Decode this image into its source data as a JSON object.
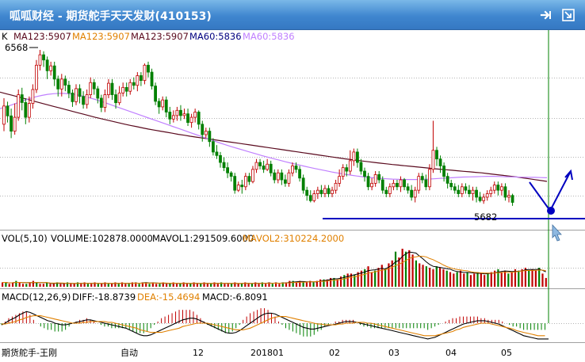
{
  "window": {
    "title": "呱呱财经 - 期货舵手天天发财(410153)",
    "pin_icon": "pin-icon",
    "restore_icon": "restore-icon"
  },
  "colors": {
    "up": "#c00000",
    "down": "#008000",
    "ma123": "#5a0a1e",
    "ma60": "#c080ff",
    "mavol1": "#000000",
    "mavol2": "#e08000",
    "diff": "#000000",
    "dea": "#e08000",
    "annotation": "#0000c0",
    "grid": "#b4b4b4"
  },
  "price_panel": {
    "k_label": "K",
    "ma123_a": "MA123:5907",
    "ma123_b": "MA123:5907",
    "ma123_c": "MA123:5907",
    "ma60_a": "MA60:5836",
    "ma60_b": "MA60:5836",
    "high_label": "6568",
    "low_label": "5682"
  },
  "volume_panel": {
    "vol_label": "VOL(5,10)",
    "volume": "VOLUME:102878.0000",
    "mavol1": "MAVOL1:291509.6000",
    "mavol2": "MAVOL2:310224.2000"
  },
  "macd_panel": {
    "macd_label": "MACD(12,26,9)",
    "diff": "DIFF:-18.8739",
    "dea": "DEA:-15.4694",
    "macd": "MACD:-6.8091"
  },
  "footer": {
    "author": "期货舵手-王刚",
    "auto": "自动"
  },
  "x_axis": {
    "labels": [
      "12",
      "201801",
      "02",
      "03",
      "04",
      "05"
    ]
  },
  "chart_data": {
    "type": "candlestick",
    "symbol": "410153",
    "price_range": [
      5560,
      6600
    ],
    "marked_high": 6568,
    "marked_low": 5682,
    "candles": [
      [
        6140,
        6245,
        6100,
        6290
      ],
      [
        6245,
        6188,
        6150,
        6270
      ],
      [
        6188,
        6100,
        6060,
        6230
      ],
      [
        6100,
        6180,
        6080,
        6260
      ],
      [
        6180,
        6310,
        6160,
        6340
      ],
      [
        6310,
        6265,
        6220,
        6350
      ],
      [
        6265,
        6180,
        6140,
        6290
      ],
      [
        6180,
        6260,
        6150,
        6300
      ],
      [
        6260,
        6340,
        6230,
        6370
      ],
      [
        6340,
        6480,
        6320,
        6510
      ],
      [
        6480,
        6540,
        6450,
        6568
      ],
      [
        6540,
        6510,
        6470,
        6560
      ],
      [
        6510,
        6448,
        6400,
        6530
      ],
      [
        6448,
        6476,
        6420,
        6500
      ],
      [
        6476,
        6400,
        6360,
        6500
      ],
      [
        6400,
        6343,
        6300,
        6420
      ],
      [
        6343,
        6400,
        6300,
        6430
      ],
      [
        6400,
        6365,
        6330,
        6420
      ],
      [
        6365,
        6320,
        6290,
        6390
      ],
      [
        6320,
        6270,
        6240,
        6340
      ],
      [
        6270,
        6345,
        6250,
        6370
      ],
      [
        6345,
        6300,
        6260,
        6370
      ],
      [
        6300,
        6254,
        6230,
        6330
      ],
      [
        6254,
        6310,
        6230,
        6340
      ],
      [
        6310,
        6380,
        6290,
        6410
      ],
      [
        6380,
        6344,
        6310,
        6400
      ],
      [
        6344,
        6290,
        6260,
        6360
      ],
      [
        6290,
        6237,
        6210,
        6310
      ],
      [
        6237,
        6310,
        6210,
        6340
      ],
      [
        6310,
        6376,
        6290,
        6400
      ],
      [
        6376,
        6310,
        6280,
        6400
      ],
      [
        6310,
        6264,
        6230,
        6340
      ],
      [
        6264,
        6320,
        6250,
        6360
      ],
      [
        6320,
        6352,
        6300,
        6380
      ],
      [
        6352,
        6330,
        6300,
        6380
      ],
      [
        6330,
        6380,
        6310,
        6400
      ],
      [
        6380,
        6364,
        6340,
        6410
      ],
      [
        6364,
        6420,
        6330,
        6440
      ],
      [
        6420,
        6392,
        6360,
        6440
      ],
      [
        6392,
        6480,
        6370,
        6490
      ],
      [
        6480,
        6440,
        6410,
        6500
      ],
      [
        6440,
        6360,
        6340,
        6460
      ],
      [
        6360,
        6272,
        6250,
        6380
      ],
      [
        6272,
        6240,
        6200,
        6290
      ],
      [
        6240,
        6280,
        6220,
        6300
      ],
      [
        6280,
        6210,
        6180,
        6300
      ],
      [
        6210,
        6170,
        6140,
        6240
      ],
      [
        6170,
        6190,
        6150,
        6220
      ],
      [
        6190,
        6220,
        6160,
        6240
      ],
      [
        6220,
        6190,
        6160,
        6250
      ],
      [
        6190,
        6200,
        6170,
        6230
      ],
      [
        6200,
        6150,
        6130,
        6230
      ],
      [
        6150,
        6180,
        6120,
        6200
      ],
      [
        6180,
        6210,
        6150,
        6230
      ],
      [
        6210,
        6140,
        6110,
        6220
      ],
      [
        6140,
        6080,
        6040,
        6160
      ],
      [
        6080,
        6100,
        6060,
        6120
      ],
      [
        6100,
        6040,
        6010,
        6120
      ],
      [
        6040,
        5980,
        5960,
        6060
      ],
      [
        5980,
        5960,
        5940,
        6020
      ],
      [
        5960,
        5920,
        5890,
        5980
      ],
      [
        5920,
        5890,
        5870,
        5950
      ],
      [
        5890,
        5860,
        5830,
        5920
      ],
      [
        5860,
        5840,
        5810,
        5870
      ],
      [
        5840,
        5760,
        5740,
        5860
      ],
      [
        5760,
        5790,
        5750,
        5810
      ],
      [
        5790,
        5780,
        5740,
        5820
      ],
      [
        5780,
        5840,
        5760,
        5860
      ],
      [
        5840,
        5810,
        5790,
        5860
      ],
      [
        5810,
        5880,
        5800,
        5900
      ],
      [
        5880,
        5920,
        5860,
        5940
      ],
      [
        5920,
        5900,
        5880,
        5940
      ],
      [
        5900,
        5880,
        5860,
        5930
      ],
      [
        5880,
        5910,
        5870,
        5940
      ],
      [
        5910,
        5860,
        5840,
        5930
      ],
      [
        5860,
        5820,
        5800,
        5880
      ],
      [
        5820,
        5860,
        5800,
        5880
      ],
      [
        5860,
        5820,
        5790,
        5880
      ],
      [
        5820,
        5800,
        5780,
        5850
      ],
      [
        5800,
        5860,
        5780,
        5880
      ],
      [
        5860,
        5900,
        5840,
        5920
      ],
      [
        5900,
        5880,
        5860,
        5920
      ],
      [
        5880,
        5830,
        5810,
        5900
      ],
      [
        5830,
        5760,
        5740,
        5850
      ],
      [
        5760,
        5730,
        5700,
        5780
      ],
      [
        5730,
        5700,
        5690,
        5760
      ],
      [
        5700,
        5740,
        5690,
        5760
      ],
      [
        5740,
        5760,
        5710,
        5780
      ],
      [
        5760,
        5740,
        5720,
        5790
      ],
      [
        5740,
        5770,
        5720,
        5790
      ],
      [
        5770,
        5740,
        5720,
        5790
      ],
      [
        5740,
        5760,
        5720,
        5780
      ],
      [
        5760,
        5800,
        5740,
        5820
      ],
      [
        5800,
        5840,
        5780,
        5880
      ],
      [
        5840,
        5890,
        5820,
        5910
      ],
      [
        5890,
        5870,
        5840,
        5910
      ],
      [
        5870,
        5930,
        5850,
        5990
      ],
      [
        5930,
        5980,
        5900,
        6000
      ],
      [
        5980,
        5920,
        5890,
        6000
      ],
      [
        5920,
        5870,
        5850,
        5940
      ],
      [
        5870,
        5840,
        5810,
        5890
      ],
      [
        5840,
        5780,
        5760,
        5860
      ],
      [
        5780,
        5800,
        5760,
        5830
      ],
      [
        5800,
        5850,
        5780,
        5870
      ],
      [
        5850,
        5820,
        5800,
        5870
      ],
      [
        5820,
        5760,
        5740,
        5840
      ],
      [
        5760,
        5740,
        5720,
        5780
      ],
      [
        5740,
        5780,
        5720,
        5800
      ],
      [
        5780,
        5800,
        5760,
        5820
      ],
      [
        5800,
        5780,
        5760,
        5820
      ],
      [
        5780,
        5820,
        5750,
        5840
      ],
      [
        5820,
        5780,
        5760,
        5830
      ],
      [
        5780,
        5760,
        5740,
        5800
      ],
      [
        5760,
        5720,
        5700,
        5790
      ],
      [
        5720,
        5760,
        5690,
        5780
      ],
      [
        5760,
        5840,
        5740,
        5860
      ],
      [
        5840,
        5820,
        5800,
        5860
      ],
      [
        5820,
        5780,
        5760,
        5850
      ],
      [
        5780,
        5880,
        5760,
        5910
      ],
      [
        5880,
        5990,
        5860,
        6160
      ],
      [
        5990,
        5940,
        5900,
        6010
      ],
      [
        5940,
        5900,
        5860,
        5960
      ],
      [
        5900,
        5840,
        5810,
        5920
      ],
      [
        5840,
        5800,
        5770,
        5860
      ],
      [
        5800,
        5780,
        5760,
        5820
      ],
      [
        5780,
        5760,
        5740,
        5800
      ],
      [
        5760,
        5740,
        5720,
        5790
      ],
      [
        5740,
        5780,
        5720,
        5800
      ],
      [
        5780,
        5760,
        5740,
        5800
      ],
      [
        5760,
        5740,
        5720,
        5790
      ],
      [
        5740,
        5760,
        5700,
        5780
      ],
      [
        5760,
        5720,
        5690,
        5780
      ],
      [
        5720,
        5700,
        5690,
        5750
      ],
      [
        5700,
        5720,
        5682,
        5740
      ],
      [
        5720,
        5740,
        5700,
        5760
      ],
      [
        5740,
        5760,
        5720,
        5780
      ],
      [
        5760,
        5790,
        5740,
        5810
      ],
      [
        5790,
        5760,
        5730,
        5810
      ],
      [
        5760,
        5780,
        5730,
        5800
      ],
      [
        5780,
        5720,
        5700,
        5800
      ],
      [
        5720,
        5730,
        5690,
        5760
      ],
      [
        5730,
        5690,
        5670,
        5740
      ]
    ],
    "ma123": [
      6325,
      6316,
      6307,
      6298,
      6289,
      6280,
      6270,
      6261,
      6252,
      6243,
      6234,
      6225,
      6216,
      6207,
      6198,
      6189,
      6180,
      6172,
      6164,
      6156,
      6148,
      6140,
      6133,
      6126,
      6119,
      6112,
      6106,
      6100,
      6094,
      6088,
      6082,
      6077,
      6071,
      6066,
      6061,
      6056,
      6051,
      6046,
      6041,
      6036,
      6031,
      6026,
      6021,
      6016,
      6011,
      6006,
      6001,
      5996,
      5991,
      5986,
      5981,
      5976,
      5971,
      5966,
      5961,
      5956,
      5951,
      5946,
      5941,
      5937,
      5932,
      5928,
      5924,
      5920,
      5916,
      5912,
      5908,
      5905,
      5901,
      5898,
      5895,
      5891,
      5888,
      5884,
      5881,
      5878,
      5875,
      5872,
      5869,
      5866,
      5863,
      5860,
      5856,
      5852,
      5848,
      5844,
      5840,
      5836,
      5831,
      5826,
      5821,
      5816,
      5811
    ],
    "ma60": [
      6230,
      6240,
      6252,
      6264,
      6277,
      6288,
      6298,
      6306,
      6312,
      6316,
      6318,
      6317,
      6314,
      6309,
      6302,
      6293,
      6283,
      6272,
      6260,
      6248,
      6236,
      6224,
      6212,
      6200,
      6188,
      6176,
      6164,
      6152,
      6140,
      6128,
      6116,
      6104,
      6092,
      6080,
      6068,
      6056,
      6044,
      6032,
      6021,
      6010,
      6000,
      5990,
      5980,
      5970,
      5960,
      5951,
      5942,
      5933,
      5924,
      5916,
      5908,
      5900,
      5892,
      5885,
      5878,
      5871,
      5864,
      5858,
      5852,
      5847,
      5842,
      5838,
      5834,
      5831,
      5828,
      5826,
      5824,
      5823,
      5822,
      5822,
      5822,
      5823,
      5824,
      5826,
      5828,
      5830,
      5832,
      5834,
      5836,
      5837,
      5838,
      5839,
      5840,
      5840,
      5839,
      5838,
      5837,
      5836,
      5835,
      5834,
      5834,
      5833,
      5832
    ],
    "volume": [
      3,
      3,
      2,
      3,
      4,
      3,
      2,
      2,
      3,
      4,
      3,
      2,
      2,
      3,
      2,
      2,
      3,
      2,
      2,
      3,
      2,
      2,
      3,
      2,
      3,
      2,
      2,
      3,
      2,
      2,
      3,
      2,
      2,
      3,
      2,
      3,
      2,
      2,
      3,
      3,
      2,
      3,
      3,
      2,
      3,
      2,
      2,
      3,
      2,
      2,
      3,
      2,
      2,
      3,
      2,
      2,
      3,
      2,
      2,
      3,
      2,
      2,
      3,
      2,
      3,
      2,
      2,
      2,
      3,
      2,
      2,
      3,
      2,
      2,
      3,
      2,
      3,
      2,
      3,
      2,
      3,
      2,
      3,
      3,
      4,
      4,
      3,
      4,
      3,
      3,
      4,
      3,
      4,
      5,
      5,
      5,
      6,
      6,
      5,
      7,
      8,
      9,
      9,
      8,
      10,
      11,
      12,
      14,
      10,
      11,
      13,
      15,
      12,
      16,
      18,
      24,
      20,
      26,
      24,
      25,
      22,
      18,
      16,
      15,
      14,
      13,
      12,
      14,
      13,
      12,
      11,
      10,
      9,
      10,
      11,
      9,
      10,
      8,
      9,
      10,
      9,
      8,
      9,
      10,
      11,
      12,
      10,
      11,
      9,
      10,
      12,
      11,
      12,
      13,
      11,
      12,
      11,
      13,
      9,
      6
    ],
    "macd_diff": [
      -2,
      0,
      3,
      5,
      7,
      10,
      12,
      14,
      13,
      11,
      9,
      7,
      5,
      3,
      2,
      0,
      -1,
      -2,
      -2,
      -1,
      0,
      1,
      2,
      3,
      4,
      4,
      3,
      2,
      1,
      0,
      -1,
      -2,
      -3,
      -4,
      -5,
      -6,
      -8,
      -10,
      -12,
      -14,
      -15,
      -15,
      -14,
      -12,
      -10,
      -8,
      -6,
      -4,
      -2,
      0,
      2,
      4,
      5,
      6,
      6,
      5,
      3,
      1,
      -1,
      -3,
      -5,
      -7,
      -9,
      -11,
      -12,
      -12,
      -11,
      -9,
      -6,
      -3,
      0,
      3,
      6,
      9,
      11,
      12,
      12,
      11,
      9,
      7,
      5,
      3,
      1,
      -1,
      -3,
      -5,
      -6,
      -7,
      -7,
      -6,
      -5,
      -4,
      -3,
      -2,
      -1,
      0,
      1,
      2,
      2,
      2,
      1,
      0,
      -1,
      -2,
      -3,
      -4,
      -5,
      -6,
      -7,
      -8,
      -9,
      -10,
      -11,
      -12,
      -13,
      -14,
      -15,
      -16,
      -17,
      -18,
      -19,
      -18,
      -17,
      -15,
      -13,
      -11,
      -9,
      -7,
      -5,
      -3,
      -1,
      0,
      1,
      2,
      3,
      3,
      3,
      2,
      1,
      0,
      -1,
      -3,
      -5,
      -7,
      -9,
      -11,
      -13,
      -15,
      -16,
      -17,
      -18,
      -19,
      -19,
      -19,
      -19
    ],
    "macd_dea": [
      -1,
      -1,
      0,
      1,
      2,
      4,
      5,
      7,
      8,
      9,
      9,
      9,
      8,
      7,
      6,
      5,
      4,
      3,
      2,
      1,
      0,
      0,
      0,
      1,
      1,
      2,
      2,
      2,
      2,
      2,
      1,
      1,
      0,
      -1,
      -2,
      -3,
      -4,
      -5,
      -6,
      -8,
      -9,
      -10,
      -11,
      -11,
      -11,
      -11,
      -10,
      -9,
      -8,
      -7,
      -6,
      -4,
      -3,
      -2,
      -1,
      0,
      0,
      0,
      0,
      -1,
      -2,
      -3,
      -4,
      -5,
      -6,
      -7,
      -8,
      -8,
      -8,
      -7,
      -6,
      -4,
      -2,
      0,
      2,
      4,
      6,
      7,
      8,
      8,
      8,
      7,
      6,
      5,
      4,
      3,
      2,
      1,
      0,
      -1,
      -1,
      -2,
      -2,
      -2,
      -2,
      -1,
      -1,
      0,
      0,
      0,
      1,
      1,
      1,
      0,
      0,
      -1,
      -2,
      -3,
      -4,
      -5,
      -6,
      -7,
      -8,
      -9,
      -10,
      -11,
      -12,
      -13,
      -14,
      -15,
      -15,
      -15,
      -15,
      -14,
      -13,
      -12,
      -11,
      -10,
      -8,
      -7,
      -5,
      -4,
      -3,
      -2,
      -1,
      0,
      0,
      0,
      -1,
      -2,
      -3,
      -4,
      -5,
      -6,
      -7,
      -9,
      -10,
      -11,
      -12,
      -13,
      -14,
      -15,
      -15,
      -15
    ]
  }
}
